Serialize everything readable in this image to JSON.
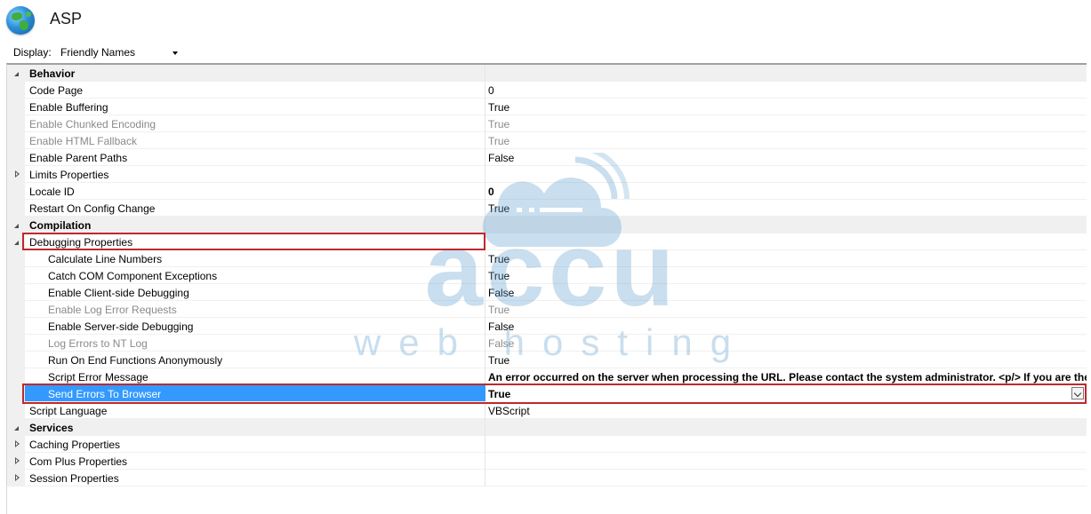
{
  "header": {
    "title": "ASP",
    "icon": "globe-icon"
  },
  "toolbar": {
    "display_label": "Display:",
    "display_value": "Friendly Names"
  },
  "grid": {
    "rows": [
      {
        "kind": "category",
        "name": "Behavior",
        "value": "",
        "toggle": "expanded",
        "indent": 0
      },
      {
        "kind": "prop",
        "name": "Code Page",
        "value": "0",
        "indent": 0
      },
      {
        "kind": "prop",
        "name": "Enable Buffering",
        "value": "True",
        "indent": 0
      },
      {
        "kind": "prop",
        "name": "Enable Chunked Encoding",
        "value": "True",
        "indent": 0,
        "disabled": true
      },
      {
        "kind": "prop",
        "name": "Enable HTML Fallback",
        "value": "True",
        "indent": 0,
        "disabled": true
      },
      {
        "kind": "prop",
        "name": "Enable Parent Paths",
        "value": "False",
        "indent": 0
      },
      {
        "kind": "prop",
        "name": "Limits Properties",
        "value": "",
        "toggle": "collapsed",
        "indent": 0
      },
      {
        "kind": "prop",
        "name": "Locale ID",
        "value": "0",
        "indent": 0,
        "bold_value": true
      },
      {
        "kind": "prop",
        "name": "Restart On Config Change",
        "value": "True",
        "indent": 0
      },
      {
        "kind": "category",
        "name": "Compilation",
        "value": "",
        "toggle": "expanded",
        "indent": 0
      },
      {
        "kind": "prop",
        "name": "Debugging Properties",
        "value": "",
        "toggle": "expanded",
        "indent": 0
      },
      {
        "kind": "prop",
        "name": "Calculate Line Numbers",
        "value": "True",
        "indent": 1
      },
      {
        "kind": "prop",
        "name": "Catch COM Component Exceptions",
        "value": "True",
        "indent": 1
      },
      {
        "kind": "prop",
        "name": "Enable Client-side Debugging",
        "value": "False",
        "indent": 1
      },
      {
        "kind": "prop",
        "name": "Enable Log Error Requests",
        "value": "True",
        "indent": 1,
        "disabled": true
      },
      {
        "kind": "prop",
        "name": "Enable Server-side Debugging",
        "value": "False",
        "indent": 1
      },
      {
        "kind": "prop",
        "name": "Log Errors to NT Log",
        "value": "False",
        "indent": 1,
        "disabled": true
      },
      {
        "kind": "prop",
        "name": "Run On End Functions Anonymously",
        "value": "True",
        "indent": 1
      },
      {
        "kind": "prop",
        "name": "Script Error Message",
        "value": "An error occurred on the server when processing the URL. Please contact the system administrator. <p/> If you are the sy",
        "indent": 1,
        "bold_value": true
      },
      {
        "kind": "selected",
        "name": "Send Errors To Browser",
        "value": "True",
        "indent": 1
      },
      {
        "kind": "prop",
        "name": "Script Language",
        "value": "VBScript",
        "indent": 0
      },
      {
        "kind": "category",
        "name": "Services",
        "value": "",
        "toggle": "expanded",
        "indent": 0
      },
      {
        "kind": "prop",
        "name": "Caching Properties",
        "value": "",
        "toggle": "collapsed",
        "indent": 0
      },
      {
        "kind": "prop",
        "name": "Com Plus Properties",
        "value": "",
        "toggle": "collapsed",
        "indent": 0
      },
      {
        "kind": "prop",
        "name": "Session Properties",
        "value": "",
        "toggle": "collapsed",
        "indent": 0
      }
    ]
  },
  "watermark": {
    "brand_top": "accu",
    "brand_bottom": "web hosting"
  },
  "colors": {
    "selection": "#3399ff",
    "highlight_box": "#c0282d",
    "category_bg": "#f0f0f0"
  }
}
